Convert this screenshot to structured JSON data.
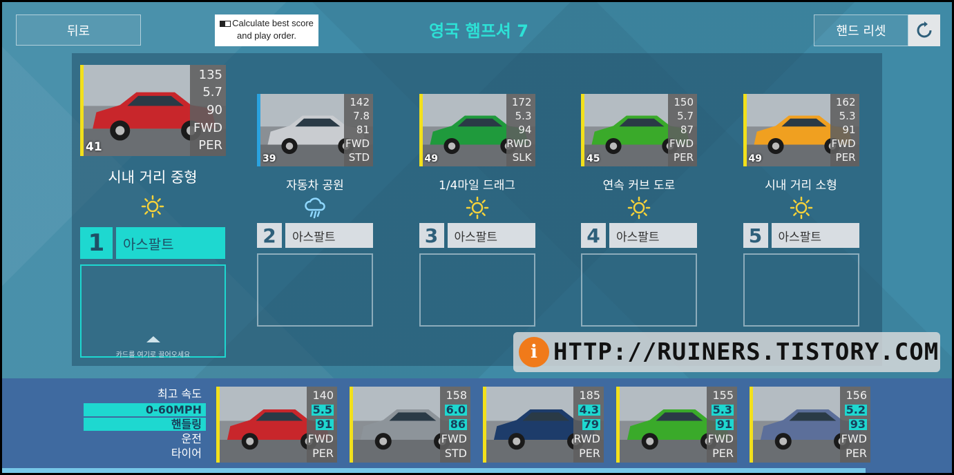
{
  "header": {
    "back_label": "뒤로",
    "calc_label": "Calculate best score and play order.",
    "title": "영국 햄프셔 7",
    "reset_label": "핸드 리셋"
  },
  "events": [
    {
      "slot": "1",
      "name": "시내 거리 중형",
      "surface": "아스팔트",
      "weather": "sun-icon",
      "card": {
        "rating": "41",
        "stats": [
          "135",
          "5.7",
          "90",
          "FWD",
          "PER"
        ],
        "color": "#c8262b"
      }
    },
    {
      "slot": "2",
      "name": "자동차 공원",
      "surface": "아스팔트",
      "weather": "rain-cloud-icon",
      "card": {
        "rating": "39",
        "stats": [
          "142",
          "7.8",
          "81",
          "FWD",
          "STD"
        ],
        "color": "#c9ccd0"
      }
    },
    {
      "slot": "3",
      "name": "1/4마일 드래그",
      "surface": "아스팔트",
      "weather": "sun-icon",
      "card": {
        "rating": "49",
        "stats": [
          "172",
          "5.3",
          "94",
          "RWD",
          "SLK"
        ],
        "color": "#1f9a3c"
      }
    },
    {
      "slot": "4",
      "name": "연속 커브 도로",
      "surface": "아스팔트",
      "weather": "sun-icon",
      "card": {
        "rating": "45",
        "stats": [
          "150",
          "5.7",
          "87",
          "FWD",
          "PER"
        ],
        "color": "#3aaa2a"
      }
    },
    {
      "slot": "5",
      "name": "시내 거리 소형",
      "surface": "아스팔트",
      "weather": "sun-icon",
      "card": {
        "rating": "49",
        "stats": [
          "162",
          "5.3",
          "91",
          "FWD",
          "PER"
        ],
        "color": "#f0a020"
      }
    }
  ],
  "drop_hint": "카드를 여기로 끌어오세요",
  "watermark": "HTTP://RUINERS.TISTORY.COM",
  "legend": [
    "최고 속도",
    "0-60MPH",
    "핸들링",
    "운전",
    "타이어"
  ],
  "hand": [
    {
      "stats": [
        "140",
        "5.5",
        "91",
        "FWD",
        "PER"
      ],
      "color": "#c8262b"
    },
    {
      "stats": [
        "158",
        "6.0",
        "86",
        "FWD",
        "STD"
      ],
      "color": "#8d949a"
    },
    {
      "stats": [
        "185",
        "4.3",
        "79",
        "RWD",
        "PER"
      ],
      "color": "#1d3c6a"
    },
    {
      "stats": [
        "155",
        "5.3",
        "91",
        "FWD",
        "PER"
      ],
      "color": "#3aaa2a"
    },
    {
      "stats": [
        "156",
        "5.2",
        "93",
        "FWD",
        "PER"
      ],
      "color": "#5c6f9a"
    }
  ],
  "colors": {
    "accent": "#1ed8d0",
    "card_stripe": "#f2e01c",
    "title": "#2de1d6"
  }
}
